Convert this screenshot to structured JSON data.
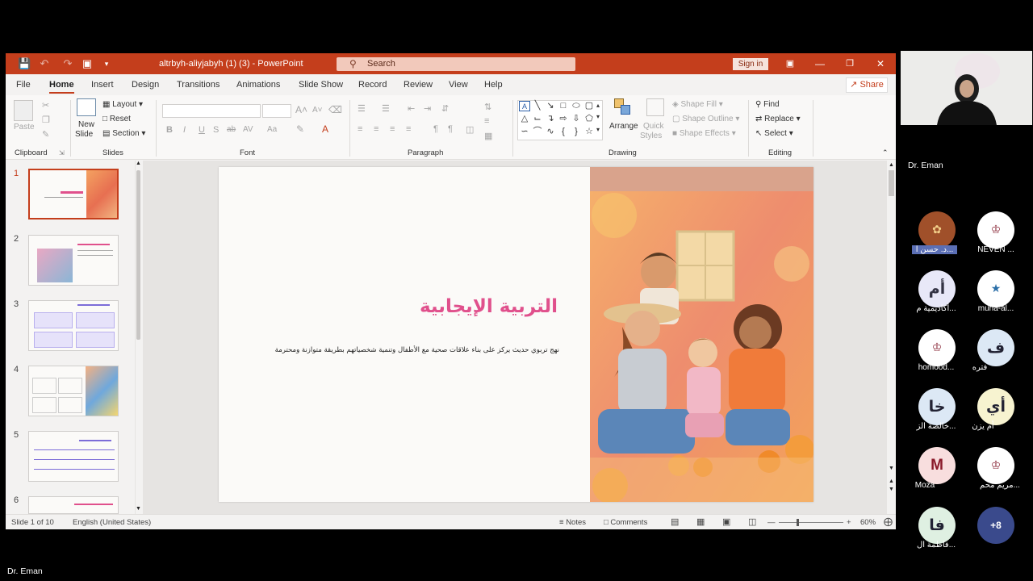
{
  "window": {
    "doc_title": "altrbyh-aliyjabyh (1) (3)  -  PowerPoint",
    "search_placeholder": "Search",
    "signin_label": "Sign in",
    "accent": "#c43e1c"
  },
  "menu": [
    "File",
    "Home",
    "Insert",
    "Design",
    "Transitions",
    "Animations",
    "Slide Show",
    "Record",
    "Review",
    "View",
    "Help"
  ],
  "share_label": "Share",
  "ribbon": {
    "clipboard": {
      "paste": "Paste",
      "label": "Clipboard"
    },
    "slides": {
      "new_slide_1": "New",
      "new_slide_2": "Slide",
      "layout": "Layout",
      "reset": "Reset",
      "section": "Section",
      "label": "Slides"
    },
    "font": {
      "label": "Font",
      "bold": "B",
      "italic": "I",
      "underline": "U",
      "strike": "S",
      "shadow": "ab",
      "spacing": "AV",
      "case": "Aa",
      "grow": "A",
      "shrink": "A"
    },
    "paragraph": {
      "label": "Paragraph"
    },
    "drawing": {
      "arrange": "Arrange",
      "quick_styles_1": "Quick",
      "quick_styles_2": "Styles",
      "shape_fill": "Shape Fill",
      "shape_outline": "Shape Outline",
      "shape_effects": "Shape Effects",
      "label": "Drawing"
    },
    "editing": {
      "find": "Find",
      "replace": "Replace",
      "select": "Select",
      "label": "Editing"
    }
  },
  "slides": {
    "numbers": [
      "1",
      "2",
      "3",
      "4",
      "5",
      "6"
    ],
    "selected": 1
  },
  "slide": {
    "title": "التربية الإيجابية",
    "subtitle": "نهج تربوي حديث يركز على بناء علاقات صحية مع الأطفال وتنمية شخصياتهم بطريقة متوازنة ومحترمة",
    "title_color": "#e0508c"
  },
  "status": {
    "slide_of": "Slide 1 of 10",
    "language": "English (United States)",
    "notes": "Notes",
    "comments": "Comments",
    "zoom": "60%"
  },
  "meeting": {
    "self_name": "Dr. Eman",
    "bottom_name": "Dr. Eman",
    "participants": [
      {
        "name": "د. حسن ا...",
        "initials": "",
        "color": "#a0502a"
      },
      {
        "name": "NEVEN ...",
        "initials": "",
        "color": "#ffffff"
      },
      {
        "name": "أكاديمية م...",
        "initials": "أم",
        "color": "#e8e8f8"
      },
      {
        "name": "muna-al...",
        "initials": "",
        "color": "#ffffff"
      },
      {
        "name": "homood...",
        "initials": "",
        "color": "#ffffff"
      },
      {
        "name": "فتره",
        "initials": "ف",
        "color": "#dce8f5"
      },
      {
        "name": "خالصة الز...",
        "initials": "خا",
        "color": "#dce8f5"
      },
      {
        "name": "أم يزن",
        "initials": "أي",
        "color": "#f7f3d0"
      },
      {
        "name": "Moza",
        "initials": "M",
        "color": "#f8dede"
      },
      {
        "name": "مريم محم...",
        "initials": "",
        "color": "#ffffff"
      },
      {
        "name": "فاطمة ال...",
        "initials": "فا",
        "color": "#dff0e2"
      }
    ],
    "more_count": "+8"
  }
}
